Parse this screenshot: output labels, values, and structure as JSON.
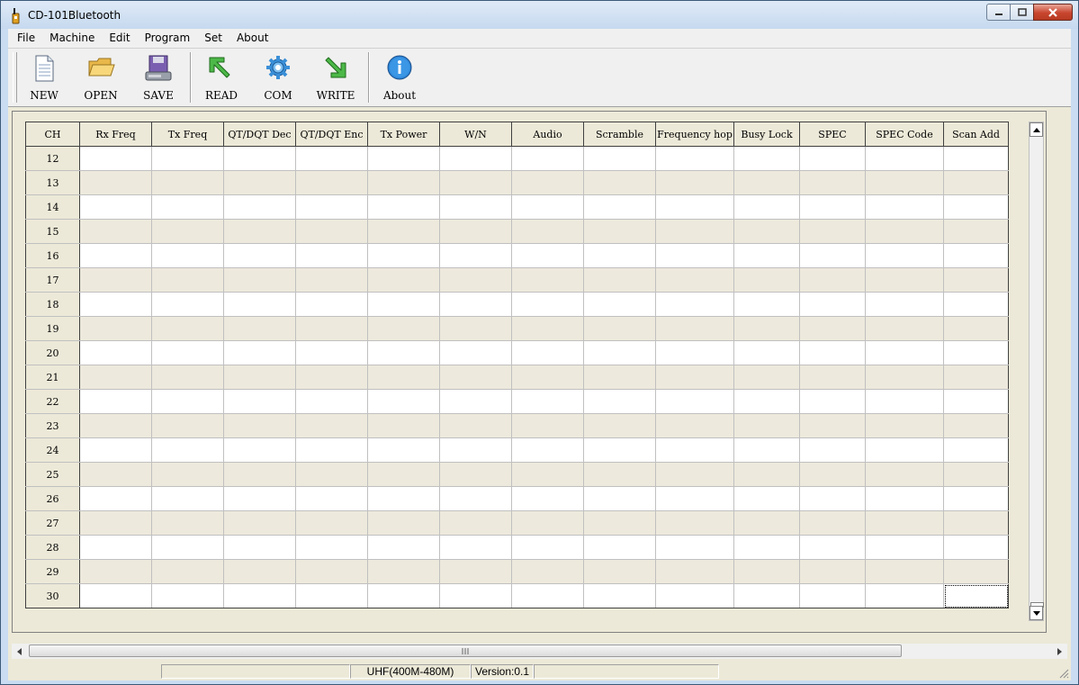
{
  "window": {
    "title": "CD-101Bluetooth",
    "controls": {
      "minimize": "minimize",
      "maximize": "maximize",
      "close": "close"
    }
  },
  "menu": [
    "File",
    "Machine",
    "Edit",
    "Program",
    "Set",
    "About"
  ],
  "toolbar": {
    "buttons": [
      {
        "label": "NEW",
        "icon": "new-document-icon"
      },
      {
        "label": "OPEN",
        "icon": "open-folder-icon"
      },
      {
        "label": "SAVE",
        "icon": "save-disk-icon"
      },
      {
        "label": "READ",
        "icon": "read-arrow-icon"
      },
      {
        "label": "COM",
        "icon": "com-gear-icon"
      },
      {
        "label": "WRITE",
        "icon": "write-arrow-icon"
      },
      {
        "label": "About",
        "icon": "info-icon"
      }
    ]
  },
  "grid": {
    "columns": [
      "CH",
      "Rx Freq",
      "Tx Freq",
      "QT/DQT Dec",
      "QT/DQT Enc",
      "Tx Power",
      "W/N",
      "Audio",
      "Scramble",
      "Frequency hop",
      "Busy Lock",
      "SPEC",
      "SPEC Code",
      "Scan Add"
    ],
    "rows": [
      "12",
      "13",
      "14",
      "15",
      "16",
      "17",
      "18",
      "19",
      "20",
      "21",
      "22",
      "23",
      "24",
      "25",
      "26",
      "27",
      "28",
      "29",
      "30"
    ]
  },
  "statusbar": {
    "pane1": "",
    "band": "UHF(400M-480M)",
    "version": "Version:0.1",
    "pane4": ""
  },
  "colors": {
    "title_bar": "#c9dcf1",
    "grid_alt_row": "#ede9dc",
    "window_bg": "#ece9d8",
    "close_button": "#c8452e"
  }
}
